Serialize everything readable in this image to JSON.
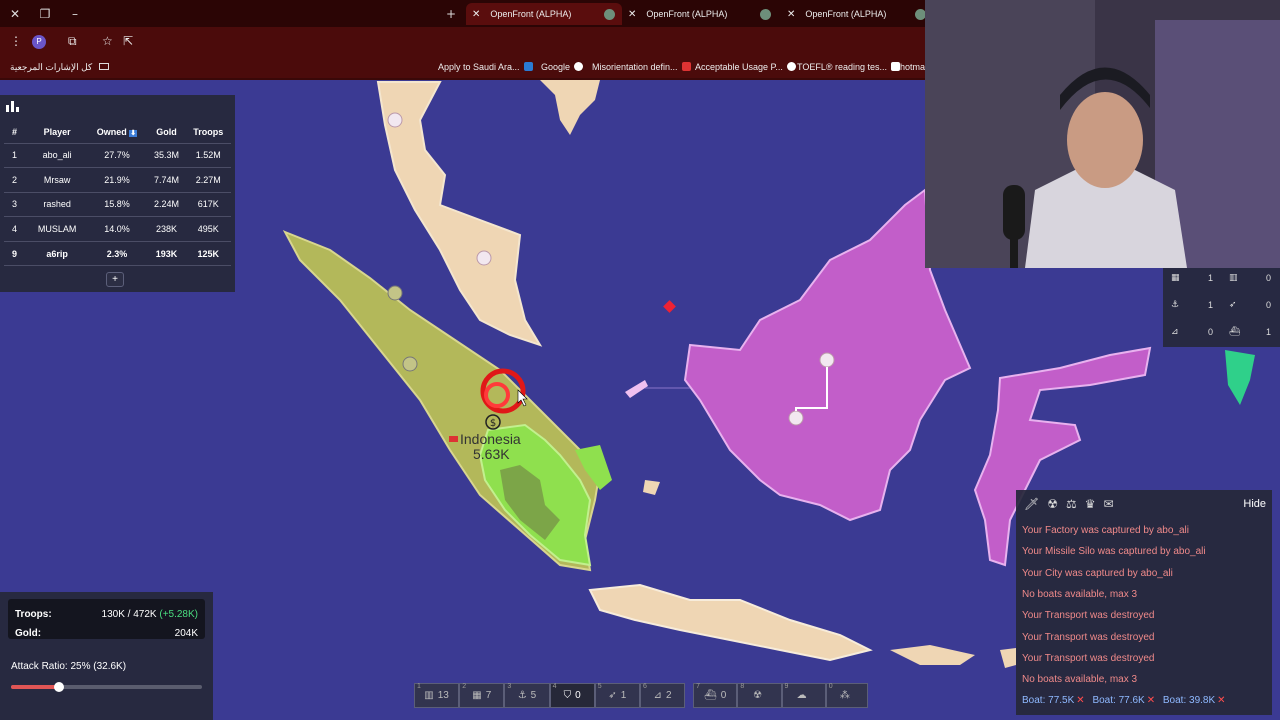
{
  "browser": {
    "tabs": [
      {
        "title": "OpenFront (ALPHA)",
        "active": true
      },
      {
        "title": "OpenFront (ALPHA)",
        "active": false
      },
      {
        "title": "OpenFront (ALPHA)",
        "active": false
      }
    ],
    "profile_initial": "P",
    "bookmarks": {
      "all_bookmarks": "كل الإشارات المرجعية",
      "items": [
        "Apply to Saudi Ara...",
        "Google",
        "Misorientation defin...",
        "Acceptable Usage P...",
        "TOEFL® reading tes...",
        "hotma"
      ]
    }
  },
  "leaderboard": {
    "headers": [
      "#",
      "Player",
      "Owned",
      "Gold",
      "Troops"
    ],
    "sort_indicator": "⬇",
    "rows": [
      {
        "rank": "1",
        "player": "abo_ali",
        "owned": "27.7%",
        "gold": "35.3M",
        "troops": "1.52M"
      },
      {
        "rank": "2",
        "player": "Mrsaw",
        "owned": "21.9%",
        "gold": "7.74M",
        "troops": "2.27M"
      },
      {
        "rank": "3",
        "player": "rashed",
        "owned": "15.8%",
        "gold": "2.24M",
        "troops": "617K"
      },
      {
        "rank": "4",
        "player": "MUSLAM",
        "owned": "14.0%",
        "gold": "238K",
        "troops": "495K"
      },
      {
        "rank": "9",
        "player": "a6rip",
        "owned": "2.3%",
        "gold": "193K",
        "troops": "125K"
      }
    ],
    "more_button": "+"
  },
  "map": {
    "nation_name": "Indonesia",
    "nation_troops": "5.63K",
    "colors": {
      "ocean": "#3b3a93",
      "sumatra": "#b3b85a",
      "peninsula": "#efd6b4",
      "borneo": "#c25ec9",
      "player": "#8fe04e"
    }
  },
  "stats": {
    "troops_label": "Troops:",
    "troops_value": "130K / 472K",
    "troops_rate": "(+5.28K)",
    "gold_label": "Gold:",
    "gold_value": "204K",
    "attack_ratio": "Attack Ratio: 25% (32.6K)",
    "attack_ratio_fraction": 0.25
  },
  "buildbar": [
    {
      "key": "1",
      "icon": "city-icon",
      "count": "13"
    },
    {
      "key": "2",
      "icon": "factory-icon",
      "count": "7"
    },
    {
      "key": "3",
      "icon": "port-icon",
      "count": "5"
    },
    {
      "key": "4",
      "icon": "defense-post-icon",
      "count": "0",
      "selected": true
    },
    {
      "key": "5",
      "icon": "missile-silo-icon",
      "count": "1"
    },
    {
      "key": "6",
      "icon": "sam-launcher-icon",
      "count": "2"
    },
    {
      "key": "7",
      "icon": "warship-icon",
      "count": "0"
    },
    {
      "key": "8",
      "icon": "atom-bomb-icon",
      "count": ""
    },
    {
      "key": "9",
      "icon": "hydrogen-bomb-icon",
      "count": ""
    },
    {
      "key": "0",
      "icon": "mirv-icon",
      "count": ""
    }
  ],
  "units": [
    {
      "icon": "factory-icon",
      "count": "1"
    },
    {
      "icon": "city-icon",
      "count": "0"
    },
    {
      "icon": "port-icon",
      "count": "1"
    },
    {
      "icon": "missile-silo-icon",
      "count": "0"
    },
    {
      "icon": "sam-launcher-icon",
      "count": "0"
    },
    {
      "icon": "warship-icon",
      "count": "1"
    }
  ],
  "events": {
    "hide_label": "Hide",
    "messages": [
      "Your Factory was captured by abo_ali",
      "Your Missile Silo was captured by abo_ali",
      "Your City was captured by abo_ali",
      "No boats available, max 3",
      "Your Transport was destroyed",
      "Your Transport was destroyed",
      "Your Transport was destroyed",
      "No boats available, max 3"
    ],
    "boats": [
      "Boat: 77.5K",
      "Boat: 77.6K",
      "Boat: 39.8K"
    ]
  }
}
